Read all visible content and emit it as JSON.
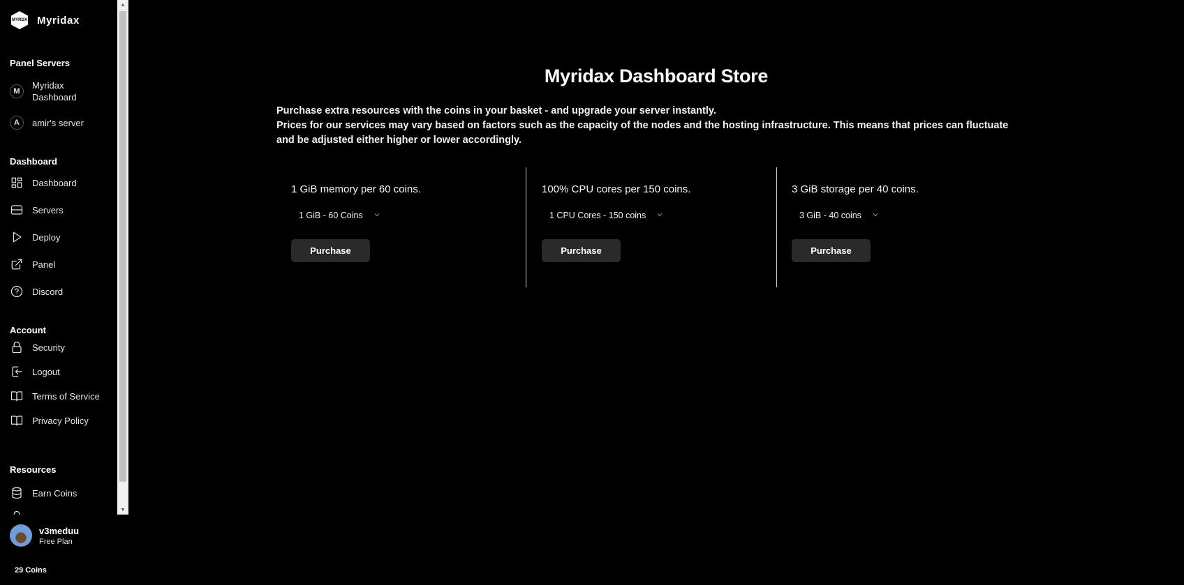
{
  "brand": {
    "name": "Myridax",
    "logo_text": "MYRDX"
  },
  "sidebar": {
    "panel_servers": {
      "title": "Panel Servers",
      "items": [
        {
          "badge": "M",
          "label": "Myridax Dashboard"
        },
        {
          "badge": "A",
          "label": "amir's server"
        }
      ]
    },
    "dashboard": {
      "title": "Dashboard",
      "items": [
        {
          "label": "Dashboard",
          "icon": "dashboard-icon"
        },
        {
          "label": "Servers",
          "icon": "servers-icon"
        },
        {
          "label": "Deploy",
          "icon": "play-icon"
        },
        {
          "label": "Panel",
          "icon": "external-link-icon"
        },
        {
          "label": "Discord",
          "icon": "help-circle-icon"
        }
      ]
    },
    "account": {
      "title": "Account",
      "items": [
        {
          "label": "Security",
          "icon": "lock-icon"
        },
        {
          "label": "Logout",
          "icon": "logout-icon"
        },
        {
          "label": "Terms of Service",
          "icon": "book-icon"
        },
        {
          "label": "Privacy Policy",
          "icon": "book-icon"
        }
      ]
    },
    "resources": {
      "title": "Resources",
      "items": [
        {
          "label": "Earn Coins",
          "icon": "coins-stack-icon"
        }
      ]
    }
  },
  "user": {
    "name": "v3meduu",
    "plan": "Free Plan",
    "coins": "29 Coins"
  },
  "store": {
    "title": "Myridax Dashboard Store",
    "intro_line1": "Purchase extra resources with the coins in your basket - and upgrade your server instantly.",
    "intro_line2": "Prices for our services may vary based on factors such as the capacity of the nodes and the hosting infrastructure. This means that prices can fluctuate and be adjusted either higher or lower accordingly.",
    "cards": [
      {
        "title": "1 GiB memory per 60 coins.",
        "selected": "1 GiB - 60 Coins",
        "button": "Purchase"
      },
      {
        "title": "100% CPU cores per 150 coins.",
        "selected": "1 CPU Cores - 150 coins",
        "button": "Purchase"
      },
      {
        "title": "3 GiB storage per 40 coins.",
        "selected": "3 GiB - 40 coins",
        "button": "Purchase"
      }
    ]
  }
}
